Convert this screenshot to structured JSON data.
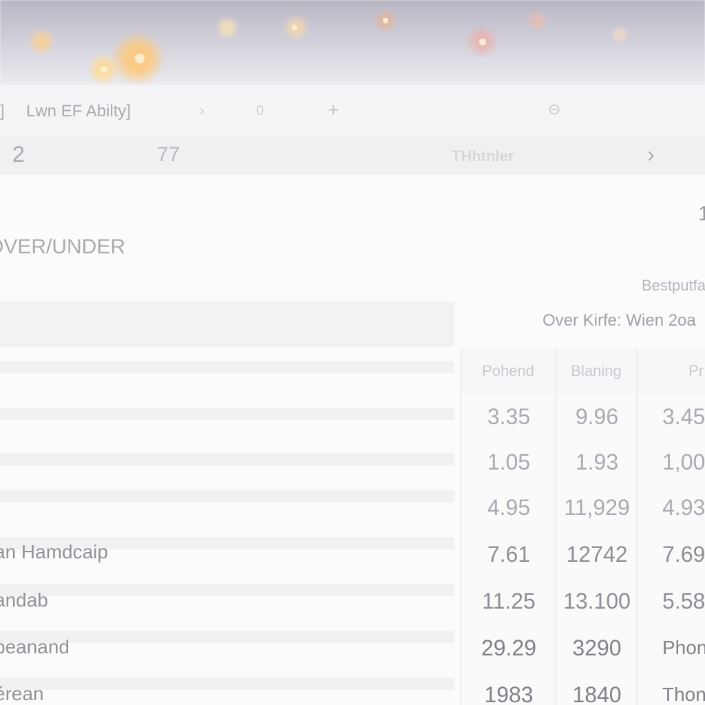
{
  "window": {
    "title": "Lwn EF Abilty]",
    "tab_count": "0",
    "title_prefix": "]"
  },
  "nav": {
    "left": "2",
    "middle": "77",
    "center_label": "THhtnler",
    "next_icon": "chevron-right-icon"
  },
  "header": {
    "heading": "OVER/UNDER",
    "corner_number": "1",
    "subtext": "Bestputfa",
    "market_label": "Over Kirfe: Wien 2oa"
  },
  "markets": [
    "an Hamdcaip",
    "andab",
    "beanand",
    "érean"
  ],
  "odds_table": {
    "columns": [
      "Pohend",
      "Blaning",
      "Pr"
    ],
    "rows": [
      [
        "3.35",
        "9.96",
        "3.45"
      ],
      [
        "1.05",
        "1.93",
        "1,00"
      ],
      [
        "4.95",
        "11,929",
        "4.93"
      ],
      [
        "7.61",
        "12742",
        "7.69"
      ],
      [
        "11.25",
        "13.100",
        "5.58"
      ],
      [
        "29.29",
        "3290",
        "Phonc"
      ],
      [
        "1983",
        "1840",
        "Thonc"
      ]
    ]
  },
  "colors": {
    "background": "#f6f6f9",
    "text": "#6c6f76",
    "divider": "#eceef0"
  }
}
